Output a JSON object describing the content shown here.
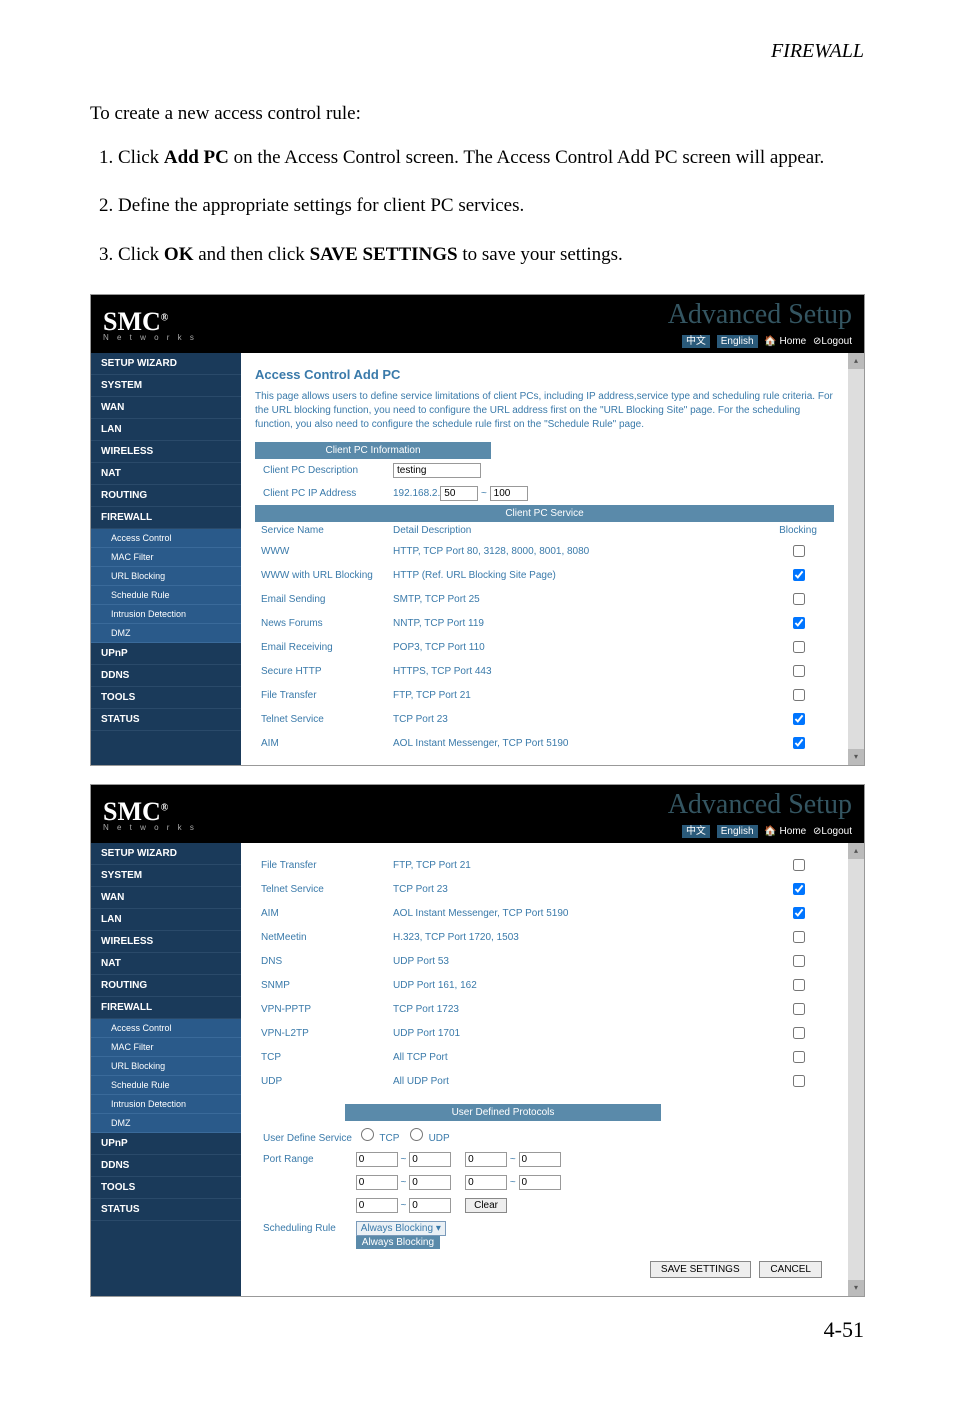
{
  "doc": {
    "section_title": "FIREWALL",
    "intro": "To create a new access control rule:",
    "steps": [
      {
        "pre": "Click ",
        "bold": "Add PC",
        "post": " on the Access Control screen. The Access Control Add PC screen will appear."
      },
      {
        "pre": "Define the appropriate settings for client PC services.",
        "bold": "",
        "post": ""
      },
      {
        "pre": "Click ",
        "bold": "OK",
        "post_mid": " and then click ",
        "bold2": "SAVE SETTINGS",
        "post": " to save your settings."
      }
    ],
    "page_number": "4-51"
  },
  "router": {
    "brand": "SMC",
    "brand_sub": "N e t w o r k s",
    "header_art": "Advanced Setup",
    "top_links": {
      "lang_cn": "中文",
      "lang_en": "English",
      "home": "Home",
      "logout": "Logout"
    },
    "nav1": [
      "SETUP WIZARD",
      "SYSTEM",
      "WAN",
      "LAN",
      "WIRELESS",
      "NAT",
      "ROUTING",
      "FIREWALL"
    ],
    "nav1_sub": [
      "Access Control",
      "MAC Filter",
      "URL Blocking",
      "Schedule Rule",
      "Intrusion Detection",
      "DMZ"
    ],
    "nav1_after": [
      "UPnP",
      "DDNS",
      "TOOLS",
      "STATUS"
    ],
    "page1": {
      "title": "Access Control Add PC",
      "desc": "This page allows users to define service limitations of client PCs, including IP address,service type and scheduling rule criteria. For the URL blocking function, you need to configure the URL address first on the \"URL Blocking Site\" page. For the scheduling function, you also need to configure the schedule rule first on the \"Schedule Rule\" page.",
      "info_head": "Client PC Information",
      "desc_label": "Client PC Description",
      "desc_val": "testing",
      "ip_label": "Client PC IP Address",
      "ip_prefix": "192.168.2.",
      "ip_a": "50",
      "ip_sep": "~",
      "ip_b": "100",
      "svc_head": "Client PC Service",
      "svc_cols": [
        "Service Name",
        "Detail Description",
        "Blocking"
      ],
      "svc_rows": [
        {
          "name": "WWW",
          "detail": "HTTP, TCP Port 80, 3128, 8000, 8001, 8080",
          "chk": false
        },
        {
          "name": "WWW with URL Blocking",
          "detail": "HTTP (Ref. URL Blocking Site Page)",
          "chk": true
        },
        {
          "name": "Email Sending",
          "detail": "SMTP, TCP Port 25",
          "chk": false
        },
        {
          "name": "News Forums",
          "detail": "NNTP, TCP Port 119",
          "chk": true
        },
        {
          "name": "Email Receiving",
          "detail": "POP3, TCP Port 110",
          "chk": false
        },
        {
          "name": "Secure HTTP",
          "detail": "HTTPS, TCP Port 443",
          "chk": false
        },
        {
          "name": "File Transfer",
          "detail": "FTP, TCP Port 21",
          "chk": false
        },
        {
          "name": "Telnet Service",
          "detail": "TCP Port 23",
          "chk": true
        },
        {
          "name": "AIM",
          "detail": "AOL Instant Messenger, TCP Port 5190",
          "chk": true
        }
      ]
    },
    "nav2": [
      "SETUP WIZARD",
      "SYSTEM",
      "WAN",
      "LAN",
      "WIRELESS",
      "NAT",
      "ROUTING",
      "FIREWALL"
    ],
    "nav2_sub": [
      "Access Control",
      "MAC Filter",
      "URL Blocking",
      "Schedule Rule",
      "Intrusion Detection",
      "DMZ"
    ],
    "nav2_after": [
      "UPnP",
      "DDNS",
      "TOOLS",
      "STATUS"
    ],
    "page2": {
      "svc_rows": [
        {
          "name": "File Transfer",
          "detail": "FTP, TCP Port 21",
          "chk": false
        },
        {
          "name": "Telnet Service",
          "detail": "TCP Port 23",
          "chk": true
        },
        {
          "name": "AIM",
          "detail": "AOL Instant Messenger, TCP Port 5190",
          "chk": true
        },
        {
          "name": "NetMeetin",
          "detail": "H.323, TCP Port 1720, 1503",
          "chk": false
        },
        {
          "name": "DNS",
          "detail": "UDP Port 53",
          "chk": false
        },
        {
          "name": "SNMP",
          "detail": "UDP Port 161, 162",
          "chk": false
        },
        {
          "name": "VPN-PPTP",
          "detail": "TCP Port 1723",
          "chk": false
        },
        {
          "name": "VPN-L2TP",
          "detail": "UDP Port 1701",
          "chk": false
        },
        {
          "name": "TCP",
          "detail": "All TCP Port",
          "chk": false
        },
        {
          "name": "UDP",
          "detail": "All UDP Port",
          "chk": false
        }
      ],
      "udp_head": "User Defined Protocols",
      "uds_label": "User Define Service",
      "tcp_label": "TCP",
      "udp_label": "UDP",
      "pr_label": "Port Range",
      "pr_rows": [
        {
          "a": "0",
          "b": "0",
          "c": "0",
          "d": "0"
        },
        {
          "a": "0",
          "b": "0",
          "c": "0",
          "d": "0"
        },
        {
          "a": "0",
          "b": "0",
          "clear": "Clear"
        }
      ],
      "sched_label": "Scheduling Rule",
      "sched_sel": "Always Blocking",
      "sched_drop": "Always Blocking",
      "save": "SAVE SETTINGS",
      "cancel": "CANCEL"
    }
  }
}
